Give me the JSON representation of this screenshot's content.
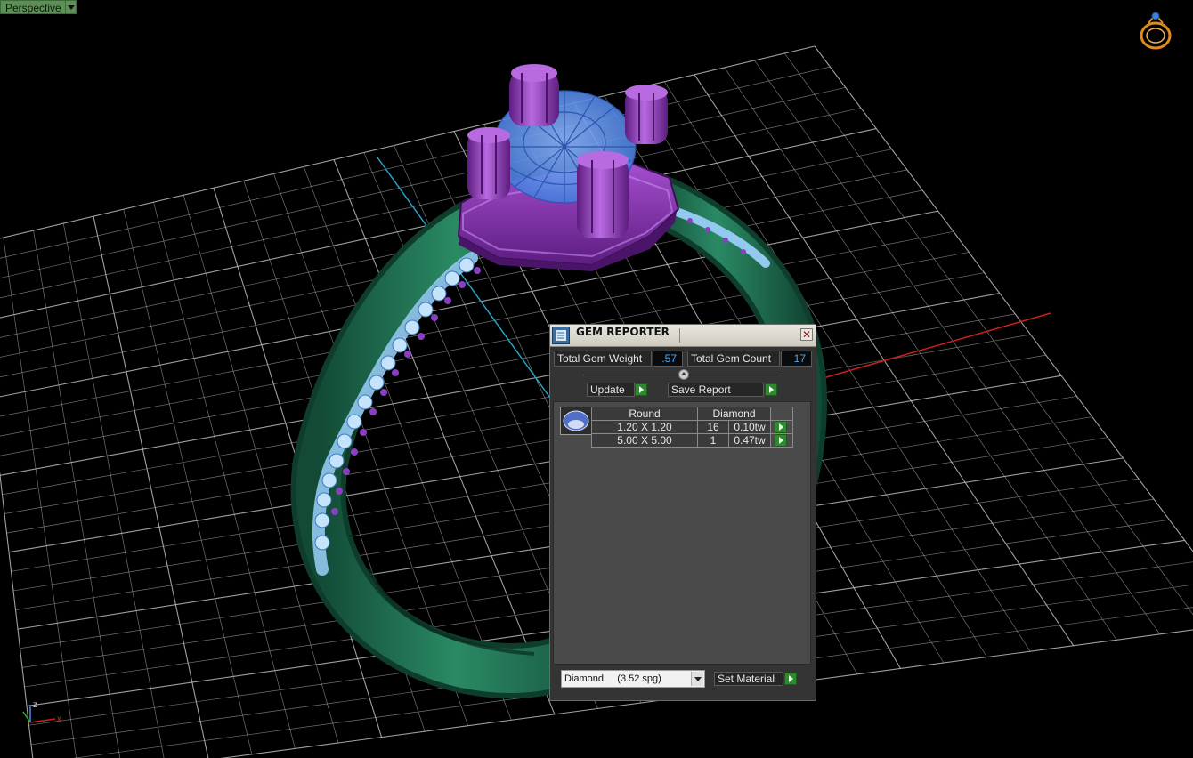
{
  "viewport": {
    "label": "Perspective",
    "grid_color": "#bdbdbd",
    "axis_colors": {
      "x": "#cc2020",
      "y": "#27a3c8"
    },
    "axis_indicator": {
      "z_label": "z",
      "x_label": "x"
    },
    "model": {
      "metal_color": "#1f6b4f",
      "head_color": "#7a2aa0",
      "gem_color": "#4d8ef0"
    }
  },
  "dialog": {
    "title": "GEM REPORTER",
    "total_weight_label": "Total Gem Weight",
    "total_weight_value": ".57",
    "total_count_label": "Total Gem Count",
    "total_count_value": "17",
    "update_label": "Update",
    "save_report_label": "Save Report",
    "table": {
      "shape": "Round",
      "material": "Diamond",
      "rows": [
        {
          "size": "1.20 X 1.20",
          "count": "16",
          "weight": "0.10tw"
        },
        {
          "size": "5.00 X 5.00",
          "count": "1",
          "weight": "0.47tw"
        }
      ]
    },
    "material_select": "Diamond     (3.52 spg)",
    "set_material_label": "Set Material"
  }
}
